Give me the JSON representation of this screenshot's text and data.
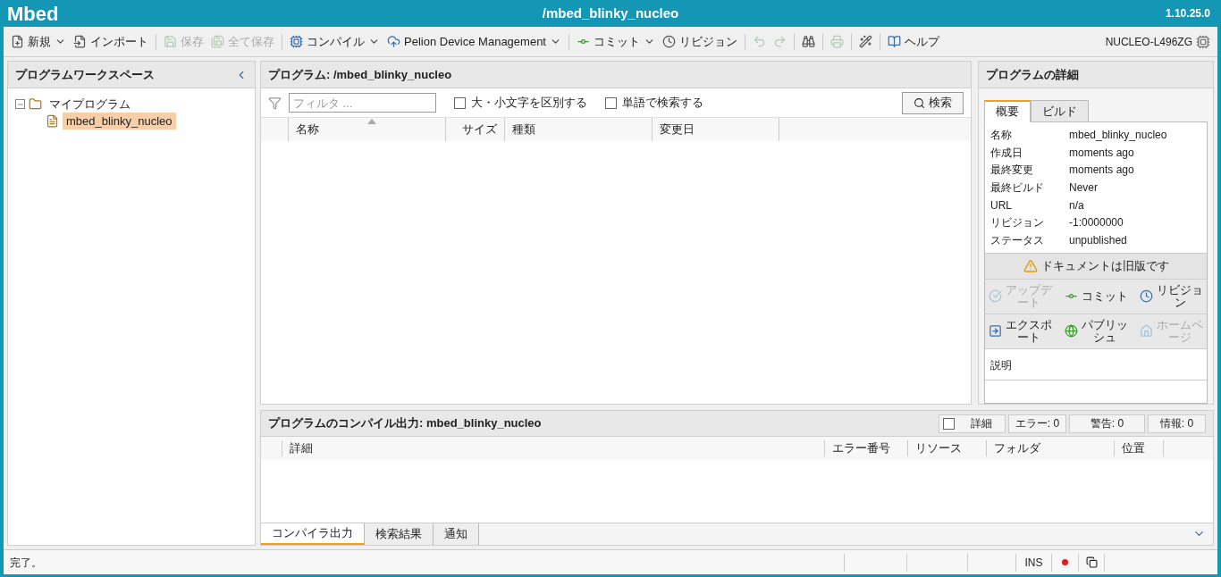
{
  "header": {
    "logo": "Mbed",
    "program": "/mbed_blinky_nucleo",
    "version": "1.10.25.0"
  },
  "toolbar": {
    "groups": [
      [
        {
          "label": "新規",
          "dropdown": true,
          "disabled": false
        },
        {
          "label": "インポート",
          "dropdown": false,
          "disabled": false
        }
      ],
      [
        {
          "label": "保存",
          "dropdown": false,
          "disabled": true
        },
        {
          "label": "全て保存",
          "dropdown": false,
          "disabled": true
        }
      ],
      [
        {
          "label": "コンパイル",
          "dropdown": true,
          "disabled": false
        },
        {
          "label": "Pelion Device Management",
          "dropdown": true,
          "disabled": false
        }
      ],
      [
        {
          "label": "コミット",
          "dropdown": true,
          "disabled": false
        },
        {
          "label": "リビジョン",
          "dropdown": false,
          "disabled": false
        }
      ],
      [
        {
          "dropdown": false,
          "disabled": true
        },
        {
          "dropdown": false,
          "disabled": true
        }
      ],
      [
        {
          "dropdown": false,
          "disabled": false
        }
      ],
      [
        {
          "dropdown": false,
          "disabled": true
        }
      ],
      [
        {
          "dropdown": false,
          "disabled": false
        }
      ],
      [
        {
          "label": "ヘルプ",
          "dropdown": false,
          "disabled": false
        }
      ]
    ],
    "device": "NUCLEO-L496ZG"
  },
  "workspace": {
    "title": "プログラムワークスペース",
    "tree": [
      {
        "label": "マイプログラム",
        "expanded": true,
        "selected": false,
        "children": [
          {
            "label": "mbed_blinky_nucleo",
            "selected": true
          }
        ]
      }
    ]
  },
  "program": {
    "title": "プログラム: /mbed_blinky_nucleo",
    "filter": {
      "placeholder": "フィルタ ..."
    },
    "options": [
      {
        "label": "大・小文字を区別する",
        "checked": false
      },
      {
        "label": "単語で検索する",
        "checked": false
      }
    ],
    "search": "検索",
    "columns": [
      {
        "label": "名称",
        "sorted": true
      },
      {
        "label": "サイズ",
        "sorted": false
      },
      {
        "label": "種類",
        "sorted": false
      },
      {
        "label": "変更日",
        "sorted": false
      }
    ]
  },
  "details": {
    "title": "プログラムの詳細",
    "tabs": [
      {
        "label": "概要",
        "selected": true
      },
      {
        "label": "ビルド",
        "selected": false
      }
    ],
    "fields": [
      {
        "label": "名称",
        "value": "mbed_blinky_nucleo"
      },
      {
        "label": "作成日",
        "value": "moments ago"
      },
      {
        "label": "最終変更",
        "value": "moments ago"
      },
      {
        "label": "最終ビルド",
        "value": "Never"
      },
      {
        "label": "URL",
        "value": "n/a"
      },
      {
        "label": "リビジョン",
        "value": "-1:0000000"
      },
      {
        "label": "ステータス",
        "value": "unpublished"
      }
    ],
    "notice": "ドキュメントは旧版です",
    "actions": [
      [
        {
          "label": "アップデート",
          "disabled": true
        },
        {
          "label": "コミット",
          "disabled": false
        },
        {
          "label": "リビジョン",
          "disabled": false
        }
      ],
      [
        {
          "label": "エクスポート",
          "disabled": false
        },
        {
          "label": "パブリッシュ",
          "disabled": false
        },
        {
          "label": "ホームページ",
          "disabled": true
        }
      ]
    ],
    "description": "説明"
  },
  "output": {
    "title": "プログラムのコンパイル出力: mbed_blinky_nucleo",
    "verbose": {
      "label": "詳細",
      "checked": false
    },
    "counters": [
      "エラー: 0",
      "警告: 0",
      "情報: 0"
    ],
    "columns": [
      "詳細",
      "エラー番号",
      "リソース",
      "フォルダ",
      "位置"
    ],
    "tabs": [
      {
        "label": "コンパイラ出力",
        "selected": true
      },
      {
        "label": "検索結果",
        "selected": false
      },
      {
        "label": "通知",
        "selected": false
      }
    ]
  },
  "status": {
    "text": "完了。",
    "mode": "INS"
  }
}
